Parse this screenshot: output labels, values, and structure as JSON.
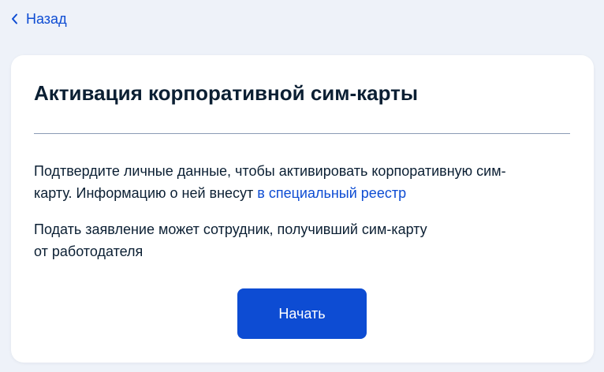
{
  "nav": {
    "back_label": "Назад",
    "back_icon": "chevron-left-icon"
  },
  "card": {
    "title": "Активация корпоративной сим-карты",
    "paragraph1": {
      "line1": "Подтвердите личные данные, чтобы активировать корпоративную сим-",
      "line2_text": "карту. Информацию о ней внесут ",
      "line2_link": "в специальный реестр"
    },
    "paragraph2": {
      "line1": "Подать заявление может сотрудник, получивший сим-карту",
      "line2": "от работодателя"
    },
    "start_button_label": "Начать"
  },
  "colors": {
    "background": "#eef2f9",
    "card": "#ffffff",
    "accent": "#0d4cd3",
    "text": "#0b1f33",
    "divider": "#8a9bb5"
  }
}
